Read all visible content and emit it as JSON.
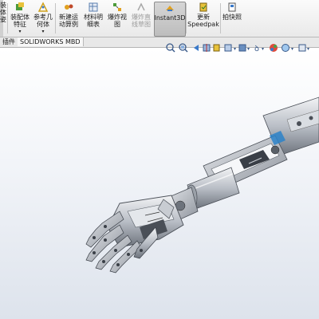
{
  "ribbon": {
    "left_labels": [
      "装",
      "体",
      "。"
    ],
    "left_lower_label": "姿",
    "buttons": [
      {
        "label": "装配体\n特征",
        "icon": "assembly-features-icon"
      },
      {
        "label": "参考几\n何体",
        "icon": "reference-geometry-icon"
      },
      {
        "label": "新建运\n动算例",
        "icon": "new-motion-study-icon"
      },
      {
        "label": "材料明\n细表",
        "icon": "bill-of-materials-icon"
      },
      {
        "label": "爆炸视\n图",
        "icon": "exploded-view-icon"
      },
      {
        "label": "爆炸直\n线草图",
        "icon": "explode-line-sketch-icon",
        "disabled": true
      },
      {
        "label": "Instant3D",
        "icon": "instant3d-icon",
        "active": true
      },
      {
        "label": "更新\nSpeedpak",
        "icon": "update-speedpak-icon"
      },
      {
        "label": "拍快照",
        "icon": "take-snapshot-icon"
      }
    ]
  },
  "tabs": [
    {
      "label": "插件"
    },
    {
      "label": "SOLIDWORKS MBD",
      "selected": true
    }
  ],
  "colors": {
    "accent": "#3a79c9",
    "model_metal": "#c8ccd2",
    "model_dark": "#4a4f57"
  }
}
